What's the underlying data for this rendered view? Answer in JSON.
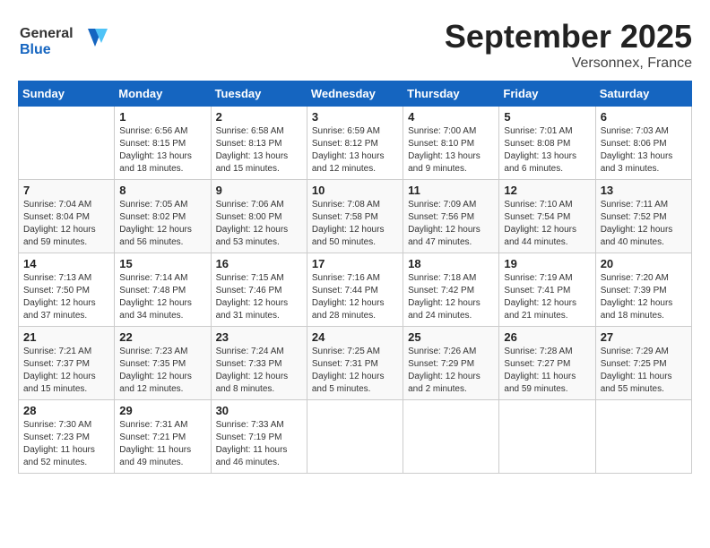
{
  "header": {
    "logo_line1": "General",
    "logo_line2": "Blue",
    "month_title": "September 2025",
    "location": "Versonnex, France"
  },
  "days_of_week": [
    "Sunday",
    "Monday",
    "Tuesday",
    "Wednesday",
    "Thursday",
    "Friday",
    "Saturday"
  ],
  "weeks": [
    [
      {
        "day": "",
        "info": ""
      },
      {
        "day": "1",
        "info": "Sunrise: 6:56 AM\nSunset: 8:15 PM\nDaylight: 13 hours\nand 18 minutes."
      },
      {
        "day": "2",
        "info": "Sunrise: 6:58 AM\nSunset: 8:13 PM\nDaylight: 13 hours\nand 15 minutes."
      },
      {
        "day": "3",
        "info": "Sunrise: 6:59 AM\nSunset: 8:12 PM\nDaylight: 13 hours\nand 12 minutes."
      },
      {
        "day": "4",
        "info": "Sunrise: 7:00 AM\nSunset: 8:10 PM\nDaylight: 13 hours\nand 9 minutes."
      },
      {
        "day": "5",
        "info": "Sunrise: 7:01 AM\nSunset: 8:08 PM\nDaylight: 13 hours\nand 6 minutes."
      },
      {
        "day": "6",
        "info": "Sunrise: 7:03 AM\nSunset: 8:06 PM\nDaylight: 13 hours\nand 3 minutes."
      }
    ],
    [
      {
        "day": "7",
        "info": "Sunrise: 7:04 AM\nSunset: 8:04 PM\nDaylight: 12 hours\nand 59 minutes."
      },
      {
        "day": "8",
        "info": "Sunrise: 7:05 AM\nSunset: 8:02 PM\nDaylight: 12 hours\nand 56 minutes."
      },
      {
        "day": "9",
        "info": "Sunrise: 7:06 AM\nSunset: 8:00 PM\nDaylight: 12 hours\nand 53 minutes."
      },
      {
        "day": "10",
        "info": "Sunrise: 7:08 AM\nSunset: 7:58 PM\nDaylight: 12 hours\nand 50 minutes."
      },
      {
        "day": "11",
        "info": "Sunrise: 7:09 AM\nSunset: 7:56 PM\nDaylight: 12 hours\nand 47 minutes."
      },
      {
        "day": "12",
        "info": "Sunrise: 7:10 AM\nSunset: 7:54 PM\nDaylight: 12 hours\nand 44 minutes."
      },
      {
        "day": "13",
        "info": "Sunrise: 7:11 AM\nSunset: 7:52 PM\nDaylight: 12 hours\nand 40 minutes."
      }
    ],
    [
      {
        "day": "14",
        "info": "Sunrise: 7:13 AM\nSunset: 7:50 PM\nDaylight: 12 hours\nand 37 minutes."
      },
      {
        "day": "15",
        "info": "Sunrise: 7:14 AM\nSunset: 7:48 PM\nDaylight: 12 hours\nand 34 minutes."
      },
      {
        "day": "16",
        "info": "Sunrise: 7:15 AM\nSunset: 7:46 PM\nDaylight: 12 hours\nand 31 minutes."
      },
      {
        "day": "17",
        "info": "Sunrise: 7:16 AM\nSunset: 7:44 PM\nDaylight: 12 hours\nand 28 minutes."
      },
      {
        "day": "18",
        "info": "Sunrise: 7:18 AM\nSunset: 7:42 PM\nDaylight: 12 hours\nand 24 minutes."
      },
      {
        "day": "19",
        "info": "Sunrise: 7:19 AM\nSunset: 7:41 PM\nDaylight: 12 hours\nand 21 minutes."
      },
      {
        "day": "20",
        "info": "Sunrise: 7:20 AM\nSunset: 7:39 PM\nDaylight: 12 hours\nand 18 minutes."
      }
    ],
    [
      {
        "day": "21",
        "info": "Sunrise: 7:21 AM\nSunset: 7:37 PM\nDaylight: 12 hours\nand 15 minutes."
      },
      {
        "day": "22",
        "info": "Sunrise: 7:23 AM\nSunset: 7:35 PM\nDaylight: 12 hours\nand 12 minutes."
      },
      {
        "day": "23",
        "info": "Sunrise: 7:24 AM\nSunset: 7:33 PM\nDaylight: 12 hours\nand 8 minutes."
      },
      {
        "day": "24",
        "info": "Sunrise: 7:25 AM\nSunset: 7:31 PM\nDaylight: 12 hours\nand 5 minutes."
      },
      {
        "day": "25",
        "info": "Sunrise: 7:26 AM\nSunset: 7:29 PM\nDaylight: 12 hours\nand 2 minutes."
      },
      {
        "day": "26",
        "info": "Sunrise: 7:28 AM\nSunset: 7:27 PM\nDaylight: 11 hours\nand 59 minutes."
      },
      {
        "day": "27",
        "info": "Sunrise: 7:29 AM\nSunset: 7:25 PM\nDaylight: 11 hours\nand 55 minutes."
      }
    ],
    [
      {
        "day": "28",
        "info": "Sunrise: 7:30 AM\nSunset: 7:23 PM\nDaylight: 11 hours\nand 52 minutes."
      },
      {
        "day": "29",
        "info": "Sunrise: 7:31 AM\nSunset: 7:21 PM\nDaylight: 11 hours\nand 49 minutes."
      },
      {
        "day": "30",
        "info": "Sunrise: 7:33 AM\nSunset: 7:19 PM\nDaylight: 11 hours\nand 46 minutes."
      },
      {
        "day": "",
        "info": ""
      },
      {
        "day": "",
        "info": ""
      },
      {
        "day": "",
        "info": ""
      },
      {
        "day": "",
        "info": ""
      }
    ]
  ]
}
